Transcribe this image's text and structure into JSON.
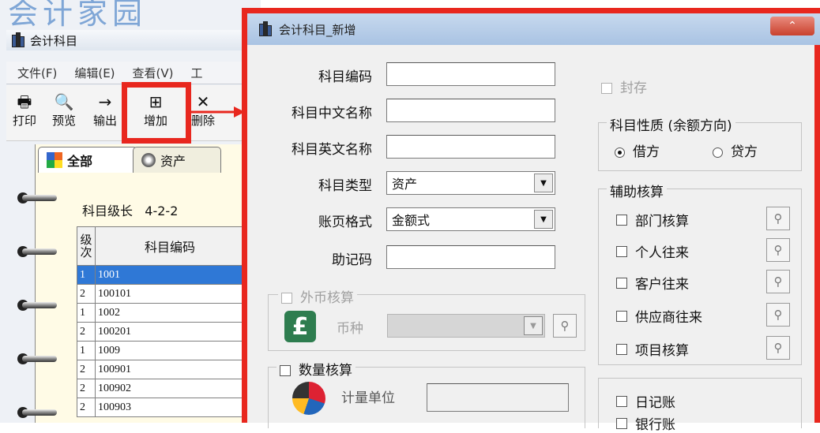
{
  "background_app": {
    "logo_text": "会计家园",
    "window_title": "会计科目",
    "menu": [
      "文件(F)",
      "编辑(E)",
      "查看(V)",
      "工"
    ],
    "toolbar": [
      {
        "label": "打印",
        "icon": "printer-icon",
        "glyph": "🖶"
      },
      {
        "label": "预览",
        "icon": "preview-icon",
        "glyph": "🔍"
      },
      {
        "label": "输出",
        "icon": "export-icon",
        "glyph": "→"
      },
      {
        "label": "增加",
        "icon": "add-icon",
        "glyph": "⊞"
      },
      {
        "label": "删除",
        "icon": "delete-icon",
        "glyph": "✕"
      }
    ],
    "tabs": [
      "全部",
      "资产"
    ],
    "level_label": "科目级长",
    "level_value": "4-2-2",
    "grid_headers": [
      "级次",
      "科目编码"
    ],
    "grid_rows": [
      {
        "level": "1",
        "code": "1001",
        "selected": true
      },
      {
        "level": "2",
        "code": "100101",
        "selected": false
      },
      {
        "level": "1",
        "code": "1002",
        "selected": false
      },
      {
        "level": "2",
        "code": "100201",
        "selected": false
      },
      {
        "level": "1",
        "code": "1009",
        "selected": false
      },
      {
        "level": "2",
        "code": "100901",
        "selected": false
      },
      {
        "level": "2",
        "code": "100902",
        "selected": false
      },
      {
        "level": "2",
        "code": "100903",
        "selected": false
      }
    ],
    "highlight_color": "#e8271e",
    "selection_color": "#2f78d6"
  },
  "dialog": {
    "title": "会计科目_新增",
    "close_glyph": "⌃",
    "fields": {
      "code_label": "科目编码",
      "cn_name_label": "科目中文名称",
      "en_name_label": "科目英文名称",
      "type_label": "科目类型",
      "type_value": "资产",
      "format_label": "账页格式",
      "format_value": "金额式",
      "mnemonic_label": "助记码"
    },
    "seal_label": "封存",
    "nature": {
      "title": "科目性质 (余额方向)",
      "debit": "借方",
      "credit": "贷方",
      "selected": "debit"
    },
    "foreign": {
      "title": "外币核算",
      "currency_label": "币种",
      "icon_glyph": "£"
    },
    "quantity": {
      "title": "数量核算",
      "unit_label": "计量单位"
    },
    "aux": {
      "title": "辅助核算",
      "items": [
        "部门核算",
        "个人往来",
        "客户往来",
        "供应商往来",
        "项目核算"
      ]
    },
    "books": [
      "日记账",
      "银行账"
    ]
  }
}
